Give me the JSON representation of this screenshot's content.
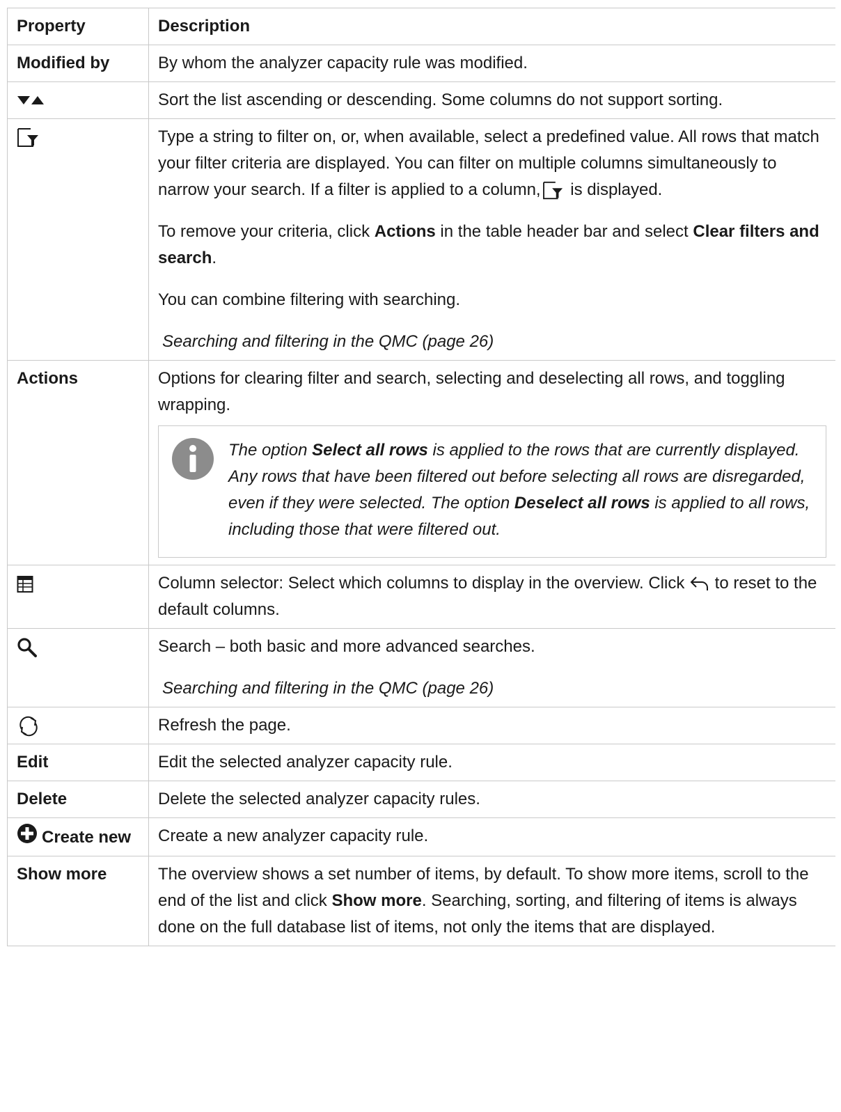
{
  "table": {
    "header": {
      "property": "Property",
      "description": "Description"
    },
    "rows": {
      "modified_by": {
        "property": "Modified by",
        "description": "By whom the analyzer capacity rule was modified."
      },
      "sort": {
        "icon": "sort-arrows-icon",
        "description": "Sort the list ascending or descending. Some columns do not support sorting."
      },
      "filter": {
        "icon": "filter-icon",
        "p1_before": "Type a string to filter on, or, when available, select a predefined value. All rows that match your filter criteria are displayed. You can filter on multiple columns simultaneously to narrow your search. If a filter is applied to a column,",
        "p1_after": " is displayed.",
        "p2_a": "To remove your criteria, click ",
        "p2_b": "Actions",
        "p2_c": " in the table header bar and select ",
        "p2_d": "Clear filters and search",
        "p2_e": ".",
        "p3": "You can combine filtering with searching.",
        "link": "Searching and filtering in the QMC (page 26)"
      },
      "actions": {
        "property": "Actions",
        "description": "Options for clearing filter and search, selecting and deselecting all rows, and toggling wrapping.",
        "note": {
          "icon": "info-icon",
          "a": "The option ",
          "b": "Select all rows",
          "c": " is applied to the rows that are currently displayed. Any rows that have been filtered out before selecting all rows are disregarded, even if they were selected. The option ",
          "d": "Deselect all rows",
          "e": " is applied to all rows, including those that were filtered out."
        }
      },
      "column_selector": {
        "icon": "column-selector-icon",
        "before": "Column selector: Select which columns to display in the overview. Click ",
        "after": " to reset to the default columns."
      },
      "search": {
        "icon": "search-icon",
        "description": "Search – both basic and more advanced searches.",
        "link": "Searching and filtering in the QMC (page 26)"
      },
      "refresh": {
        "icon": "refresh-icon",
        "description": "Refresh the page."
      },
      "edit": {
        "property": "Edit",
        "description": "Edit the selected analyzer capacity rule."
      },
      "delete": {
        "property": "Delete",
        "description": "Delete the selected analyzer capacity rules."
      },
      "create_new": {
        "icon": "plus-circle-icon",
        "property": "Create new",
        "description": "Create a new analyzer capacity rule."
      },
      "show_more": {
        "property": "Show more",
        "a": "The overview shows a set number of items, by default. To show more items, scroll to the end of the list and click ",
        "b": "Show more",
        "c": ". Searching, sorting, and filtering of items is always done on the full database list of items, not only the items that are displayed."
      }
    }
  }
}
